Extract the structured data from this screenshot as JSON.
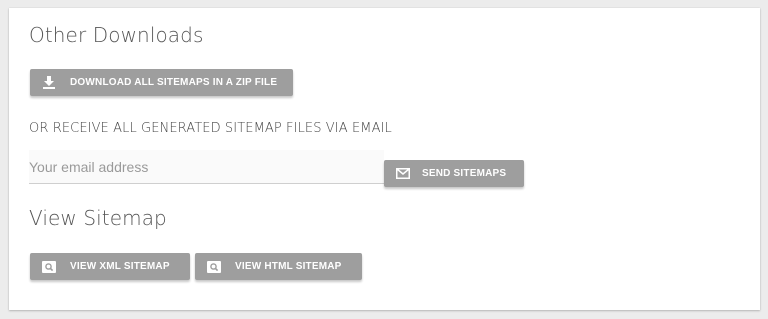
{
  "other_downloads": {
    "title": "Other Downloads",
    "zip_button_label": "DOWNLOAD ALL SITEMAPS IN A ZIP FILE",
    "email_prompt": "OR RECEIVE ALL GENERATED SITEMAP FILES VIA EMAIL",
    "email_placeholder": "Your email address",
    "email_value": "",
    "send_button_label": "SEND SITEMAPS"
  },
  "view_sitemap": {
    "title": "View Sitemap",
    "xml_button_label": "VIEW XML SITEMAP",
    "html_button_label": "VIEW HTML SITEMAP"
  },
  "icons": {
    "zip": "download-icon",
    "send": "mail-icon",
    "xml": "search-icon",
    "html": "search-icon"
  },
  "colors": {
    "button_bg": "#9e9e9e",
    "button_text": "#ffffff",
    "heading_text": "#555555",
    "page_bg": "#ececec",
    "card_bg": "#ffffff"
  }
}
